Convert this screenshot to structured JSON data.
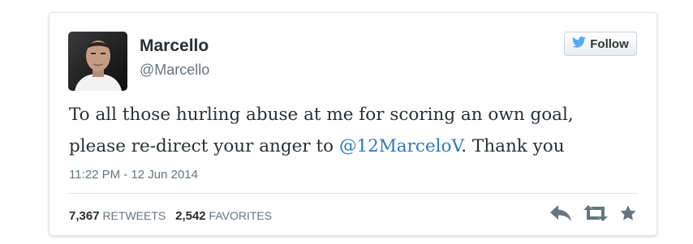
{
  "user": {
    "display_name": "Marcello",
    "handle": "@Marcello"
  },
  "follow_button": {
    "label": "Follow",
    "icon": "twitter-bird-icon"
  },
  "tweet": {
    "text_line1": "To all those hurling abuse at me for scoring an own goal,",
    "text_line2_before": "please re-direct your anger to ",
    "mention": "@12MarceloV",
    "text_line2_after": ". Thank you",
    "timestamp": "11:22 PM - 12 Jun 2014"
  },
  "stats": {
    "retweets_count": "7,367",
    "retweets_label": "RETWEETS",
    "favorites_count": "2,542",
    "favorites_label": "FAVORITES"
  },
  "actions": {
    "reply_icon": "reply-icon",
    "retweet_icon": "retweet-icon",
    "favorite_icon": "star-icon"
  },
  "colors": {
    "link": "#2b7bb9",
    "twitter_blue": "#55acee",
    "action_gray": "#66757f"
  }
}
